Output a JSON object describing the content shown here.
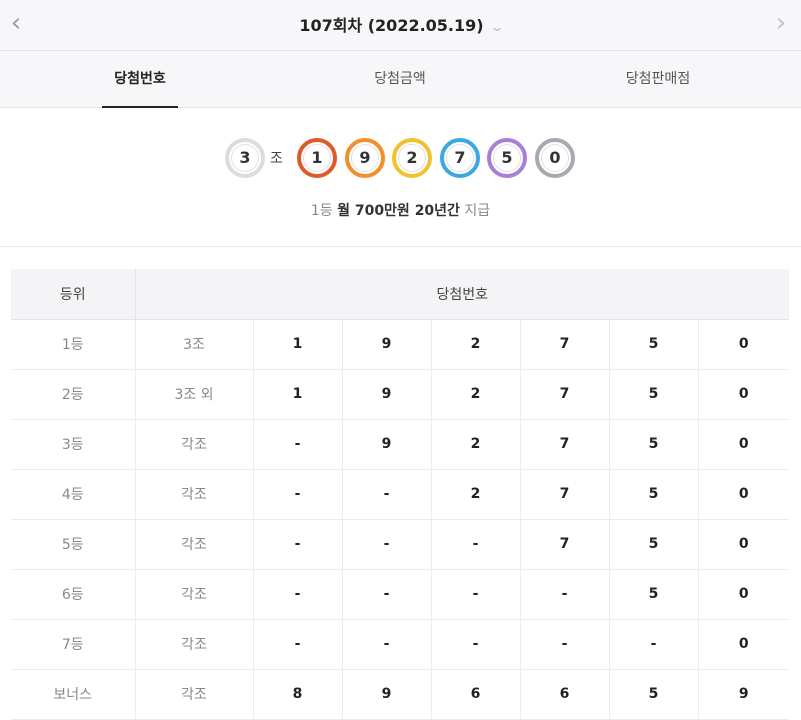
{
  "header": {
    "round_title": "107회차 (2022.05.19)"
  },
  "tabs": [
    {
      "label": "당첨번호",
      "active": true
    },
    {
      "label": "당첨금액",
      "active": false
    },
    {
      "label": "당첨판매점",
      "active": false
    }
  ],
  "winning": {
    "group_number": "3",
    "group_suffix": "조",
    "digits": [
      "1",
      "9",
      "2",
      "7",
      "5",
      "0"
    ],
    "ball_colors": {
      "group": "#dcdcdc",
      "digits": [
        "#de5a2a",
        "#f0902a",
        "#f2c12e",
        "#3aa9df",
        "#a97ed6",
        "#a8a8b0"
      ]
    },
    "prize_prefix": "1등",
    "prize_bold": "월 700만원 20년간",
    "prize_suffix": "지급"
  },
  "table": {
    "headers": {
      "rank": "등위",
      "numbers": "당첨번호"
    },
    "rows": [
      {
        "rank": "1등",
        "group": "3조",
        "digits": [
          "1",
          "9",
          "2",
          "7",
          "5",
          "0"
        ]
      },
      {
        "rank": "2등",
        "group": "3조 외",
        "digits": [
          "1",
          "9",
          "2",
          "7",
          "5",
          "0"
        ]
      },
      {
        "rank": "3등",
        "group": "각조",
        "digits": [
          "-",
          "9",
          "2",
          "7",
          "5",
          "0"
        ]
      },
      {
        "rank": "4등",
        "group": "각조",
        "digits": [
          "-",
          "-",
          "2",
          "7",
          "5",
          "0"
        ]
      },
      {
        "rank": "5등",
        "group": "각조",
        "digits": [
          "-",
          "-",
          "-",
          "7",
          "5",
          "0"
        ]
      },
      {
        "rank": "6등",
        "group": "각조",
        "digits": [
          "-",
          "-",
          "-",
          "-",
          "5",
          "0"
        ]
      },
      {
        "rank": "7등",
        "group": "각조",
        "digits": [
          "-",
          "-",
          "-",
          "-",
          "-",
          "0"
        ]
      },
      {
        "rank": "보너스",
        "group": "각조",
        "digits": [
          "8",
          "9",
          "6",
          "6",
          "5",
          "9"
        ]
      }
    ]
  }
}
